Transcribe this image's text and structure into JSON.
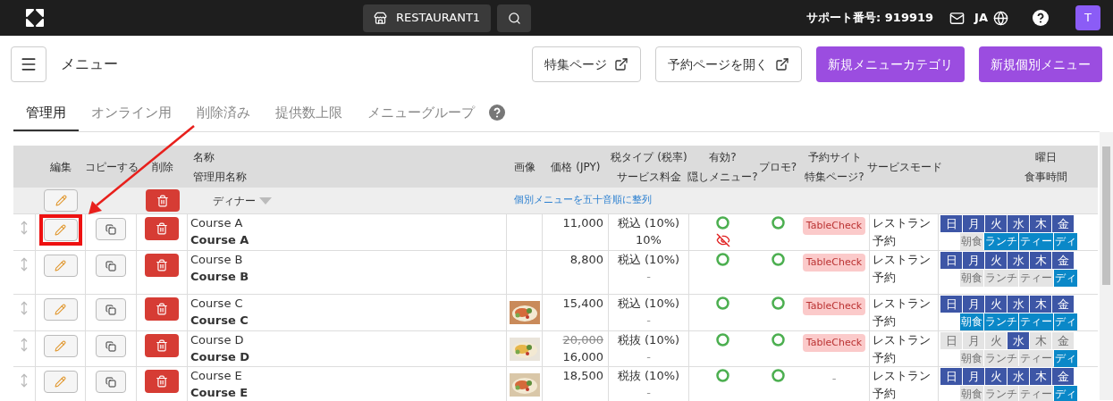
{
  "topbar": {
    "restaurant": "RESTAURANT1",
    "support": "サポート番号: 919919",
    "language": "JA",
    "avatar": "T"
  },
  "header": {
    "title": "メニュー",
    "buttons": [
      {
        "label": "特集ページ",
        "kind": "external"
      },
      {
        "label": "予約ページを開く",
        "kind": "external"
      },
      {
        "label": "新規メニューカテゴリ",
        "kind": "primary"
      },
      {
        "label": "新規個別メニュー",
        "kind": "primary"
      }
    ]
  },
  "tabs": [
    {
      "label": "管理用",
      "selected": true
    },
    {
      "label": "オンライン用",
      "selected": false
    },
    {
      "label": "削除済み",
      "selected": false
    },
    {
      "label": "提供数上限",
      "selected": false
    },
    {
      "label": "メニューグループ",
      "selected": false
    }
  ],
  "table": {
    "columns": [
      {
        "lines": [
          "編集"
        ]
      },
      {
        "lines": [
          "コピーする"
        ]
      },
      {
        "lines": [
          "削除"
        ]
      },
      {
        "lines": [
          "名称",
          "管理用名称"
        ]
      },
      {
        "lines": [
          "画像"
        ]
      },
      {
        "lines": [
          "価格 (JPY)"
        ]
      },
      {
        "lines": [
          "税タイプ (税率)",
          "サービス料金"
        ]
      },
      {
        "lines": [
          "有効?",
          "隠しメニュー?"
        ]
      },
      {
        "lines": [
          "プロモ?"
        ]
      },
      {
        "lines": [
          "予約サイト",
          "特集ページ?"
        ]
      },
      {
        "lines": [
          "サービスモード"
        ]
      },
      {
        "lines": [
          "曜日",
          "食事時間"
        ]
      }
    ],
    "category": {
      "name": "ディナー",
      "sort_link": "個別メニューを五十音順に整列"
    },
    "rows": [
      {
        "name": "Course A",
        "admin_name": "Course A",
        "has_image": false,
        "price": "11,000",
        "tax": "税込 (10%)",
        "service_charge": "10%",
        "enabled": true,
        "hidden": true,
        "promo": true,
        "site": "TableCheck",
        "service_mode": "レストラン予約",
        "highlighted": true,
        "days": [
          {
            "label": "日",
            "selected": true
          },
          {
            "label": "月",
            "selected": true
          },
          {
            "label": "火",
            "selected": true
          },
          {
            "label": "水",
            "selected": true
          },
          {
            "label": "木",
            "selected": true
          },
          {
            "label": "金",
            "selected": true
          }
        ],
        "meals": [
          {
            "label": "朝食",
            "selected": false
          },
          {
            "label": "ランチ",
            "selected": true
          },
          {
            "label": "ティー",
            "selected": true
          },
          {
            "label": "ディ",
            "selected": true
          }
        ]
      },
      {
        "name": "Course B",
        "admin_name": "Course B",
        "has_image": false,
        "price": "8,800",
        "tax": "税込 (10%)",
        "service_charge": "-",
        "enabled": true,
        "hidden": false,
        "promo": true,
        "site": "TableCheck",
        "service_mode": "レストラン予約",
        "highlighted": false,
        "days": [
          {
            "label": "日",
            "selected": true
          },
          {
            "label": "月",
            "selected": true
          },
          {
            "label": "火",
            "selected": true
          },
          {
            "label": "水",
            "selected": true
          },
          {
            "label": "木",
            "selected": true
          },
          {
            "label": "金",
            "selected": true
          }
        ],
        "meals": [
          {
            "label": "朝食",
            "selected": false
          },
          {
            "label": "ランチ",
            "selected": false
          },
          {
            "label": "ティー",
            "selected": false
          },
          {
            "label": "ディ",
            "selected": true
          }
        ]
      },
      {
        "name": "Course C",
        "admin_name": "Course C",
        "has_image": true,
        "price": "15,400",
        "tax": "税込 (10%)",
        "service_charge": "-",
        "enabled": true,
        "hidden": false,
        "promo": true,
        "site": "TableCheck",
        "service_mode": "レストラン予約",
        "highlighted": false,
        "days": [
          {
            "label": "日",
            "selected": true
          },
          {
            "label": "月",
            "selected": true
          },
          {
            "label": "火",
            "selected": true
          },
          {
            "label": "水",
            "selected": true
          },
          {
            "label": "木",
            "selected": true
          },
          {
            "label": "金",
            "selected": true
          }
        ],
        "meals": [
          {
            "label": "朝食",
            "selected": true
          },
          {
            "label": "ランチ",
            "selected": true
          },
          {
            "label": "ティー",
            "selected": true
          },
          {
            "label": "ディ",
            "selected": true
          }
        ]
      },
      {
        "name": "Course D",
        "admin_name": "Course D",
        "has_image": true,
        "original_price": "20,000",
        "price": "16,000",
        "tax": "税抜 (10%)",
        "service_charge": "-",
        "enabled": true,
        "hidden": false,
        "promo": true,
        "site": "TableCheck",
        "service_mode": "レストラン予約",
        "highlighted": false,
        "days": [
          {
            "label": "日",
            "selected": false
          },
          {
            "label": "月",
            "selected": false
          },
          {
            "label": "火",
            "selected": false
          },
          {
            "label": "水",
            "selected": true
          },
          {
            "label": "木",
            "selected": false
          },
          {
            "label": "金",
            "selected": false
          }
        ],
        "meals": [
          {
            "label": "朝食",
            "selected": false
          },
          {
            "label": "ランチ",
            "selected": false
          },
          {
            "label": "ティー",
            "selected": false
          },
          {
            "label": "ディ",
            "selected": true
          }
        ]
      },
      {
        "name": "Course E",
        "admin_name": "Course E",
        "has_image": true,
        "price": "18,500",
        "tax": "税抜 (10%)",
        "service_charge": "-",
        "enabled": true,
        "hidden": false,
        "promo": true,
        "site": "-",
        "service_mode": "レストラン予約",
        "highlighted": false,
        "days": [
          {
            "label": "日",
            "selected": true
          },
          {
            "label": "月",
            "selected": true
          },
          {
            "label": "火",
            "selected": true
          },
          {
            "label": "水",
            "selected": true
          },
          {
            "label": "木",
            "selected": true
          },
          {
            "label": "金",
            "selected": true
          }
        ],
        "meals": [
          {
            "label": "朝食",
            "selected": false
          },
          {
            "label": "ランチ",
            "selected": false
          },
          {
            "label": "ティー",
            "selected": false
          },
          {
            "label": "ディ",
            "selected": true
          }
        ]
      }
    ]
  }
}
